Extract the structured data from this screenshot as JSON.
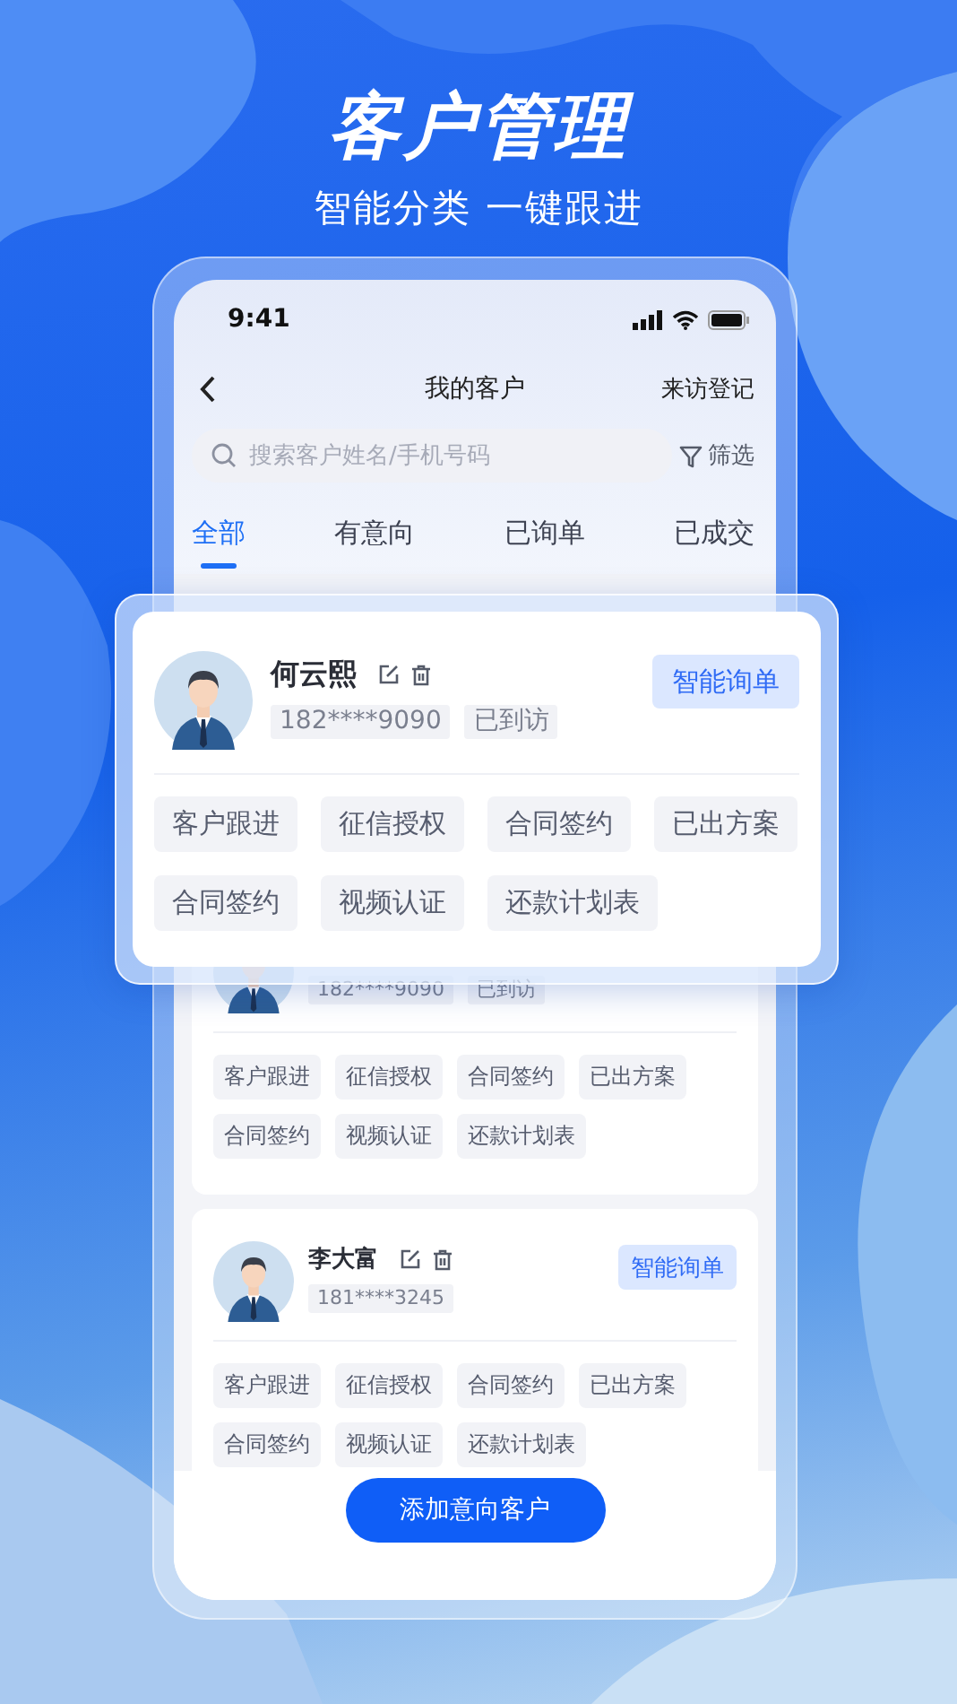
{
  "header": {
    "title": "客户管理",
    "subtitle": "智能分类 一键跟进"
  },
  "status_bar": {
    "time": "9:41"
  },
  "nav": {
    "title": "我的客户",
    "action": "来访登记"
  },
  "search": {
    "placeholder": "搜索客户姓名/手机号码",
    "filter": "筛选"
  },
  "tabs": [
    {
      "label": "全部",
      "selected": true
    },
    {
      "label": "有意向",
      "selected": false
    },
    {
      "label": "已询单",
      "selected": false
    },
    {
      "label": "已成交",
      "selected": false
    }
  ],
  "highlighted_card": {
    "name": "何云熙",
    "phone": "182****9090",
    "status": "已到访",
    "button": "智能询单",
    "tags": [
      "客户跟进",
      "征信授权",
      "合同签约",
      "已出方案",
      "合同签约",
      "视频认证",
      "还款计划表"
    ]
  },
  "customers": [
    {
      "phone": "182****9090",
      "status": "已到访",
      "tags": [
        "客户跟进",
        "征信授权",
        "合同签约",
        "已出方案",
        "合同签约",
        "视频认证",
        "还款计划表"
      ]
    },
    {
      "name": "李大富",
      "phone": "181****3245",
      "button": "智能询单",
      "tags": [
        "客户跟进",
        "征信授权",
        "合同签约",
        "已出方案",
        "合同签约",
        "视频认证",
        "还款计划表"
      ]
    }
  ],
  "add_button": "添加意向客户"
}
